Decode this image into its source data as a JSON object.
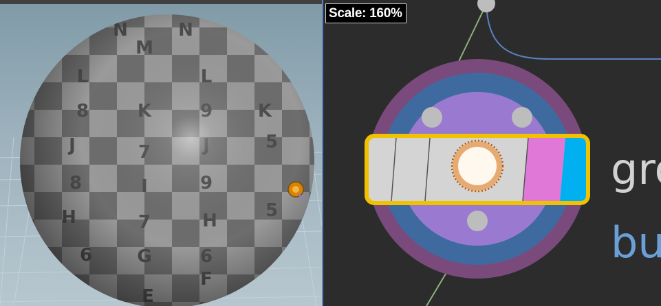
{
  "viewport": {
    "sphere_texture": "uv checker grid",
    "checker_glyphs": [
      "N",
      "7",
      "M",
      "9",
      "8",
      "L",
      "K",
      "J",
      "I",
      "H",
      "G",
      "F",
      "E",
      "5",
      "6"
    ]
  },
  "network": {
    "scale_label": "Scale: 160%",
    "node_name_fragment": "gro",
    "node_type_fragment": "bu",
    "colors": {
      "background": "#2c2c2c",
      "ring_outer": "#7a4a7c",
      "ring_middle": "#3f6aa0",
      "ring_inner": "#9a7ad0",
      "node_body": "#d4d4d4",
      "node_outline": "#f0c200",
      "bypass_flag": "#df78d6",
      "display_flag": "#00b0f0",
      "wire_green": "#8fb07a",
      "wire_blue": "#5b83c4"
    }
  }
}
